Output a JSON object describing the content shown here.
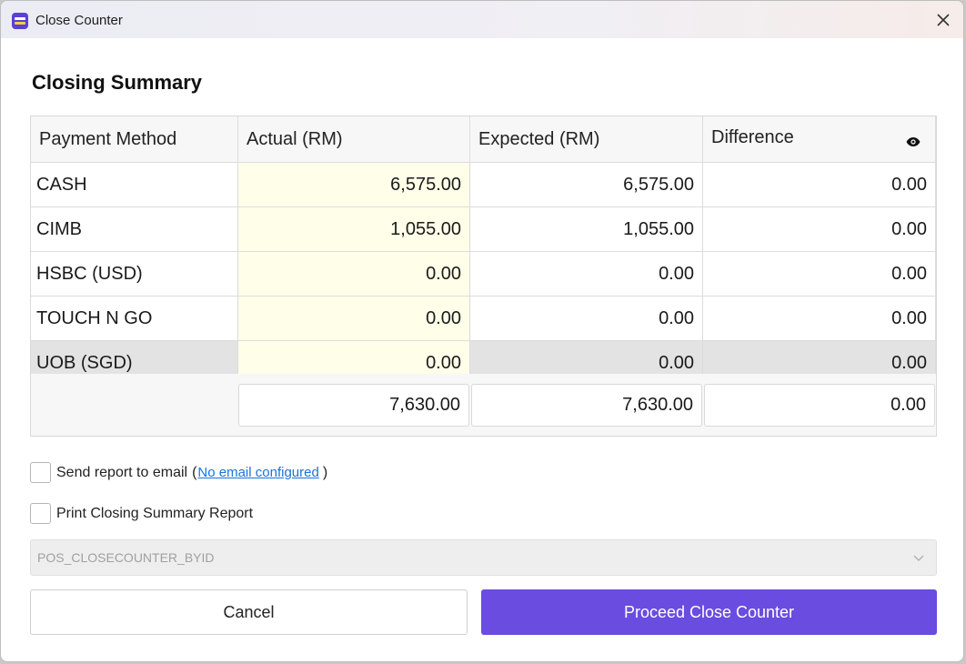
{
  "window": {
    "title": "Close Counter"
  },
  "heading": "Closing Summary",
  "table": {
    "headers": {
      "method": "Payment Method",
      "actual": "Actual (RM)",
      "expected": "Expected (RM)",
      "difference": "Difference"
    },
    "rows": [
      {
        "method": "CASH",
        "actual": "6,575.00",
        "expected": "6,575.00",
        "difference": "0.00"
      },
      {
        "method": "CIMB",
        "actual": "1,055.00",
        "expected": "1,055.00",
        "difference": "0.00"
      },
      {
        "method": "HSBC (USD)",
        "actual": "0.00",
        "expected": "0.00",
        "difference": "0.00"
      },
      {
        "method": "TOUCH N GO",
        "actual": "0.00",
        "expected": "0.00",
        "difference": "0.00"
      },
      {
        "method": "UOB (SGD)",
        "actual": "0.00",
        "expected": "0.00",
        "difference": "0.00"
      }
    ],
    "totals": {
      "actual": "7,630.00",
      "expected": "7,630.00",
      "difference": "0.00"
    }
  },
  "email": {
    "label": "Send report to email",
    "paren_open": "(",
    "link": "No email configured",
    "paren_close": ")"
  },
  "print": {
    "label": "Print Closing Summary Report"
  },
  "report_select": {
    "value": "POS_CLOSECOUNTER_BYID"
  },
  "buttons": {
    "cancel": "Cancel",
    "proceed": "Proceed Close Counter"
  },
  "colors": {
    "accent": "#6a4ce0",
    "actual_column_bg": "#fefee9",
    "link": "#1a73d9"
  },
  "icons": {
    "close": "close-icon",
    "eye": "eye-icon",
    "chevron": "chevron-down-icon"
  }
}
